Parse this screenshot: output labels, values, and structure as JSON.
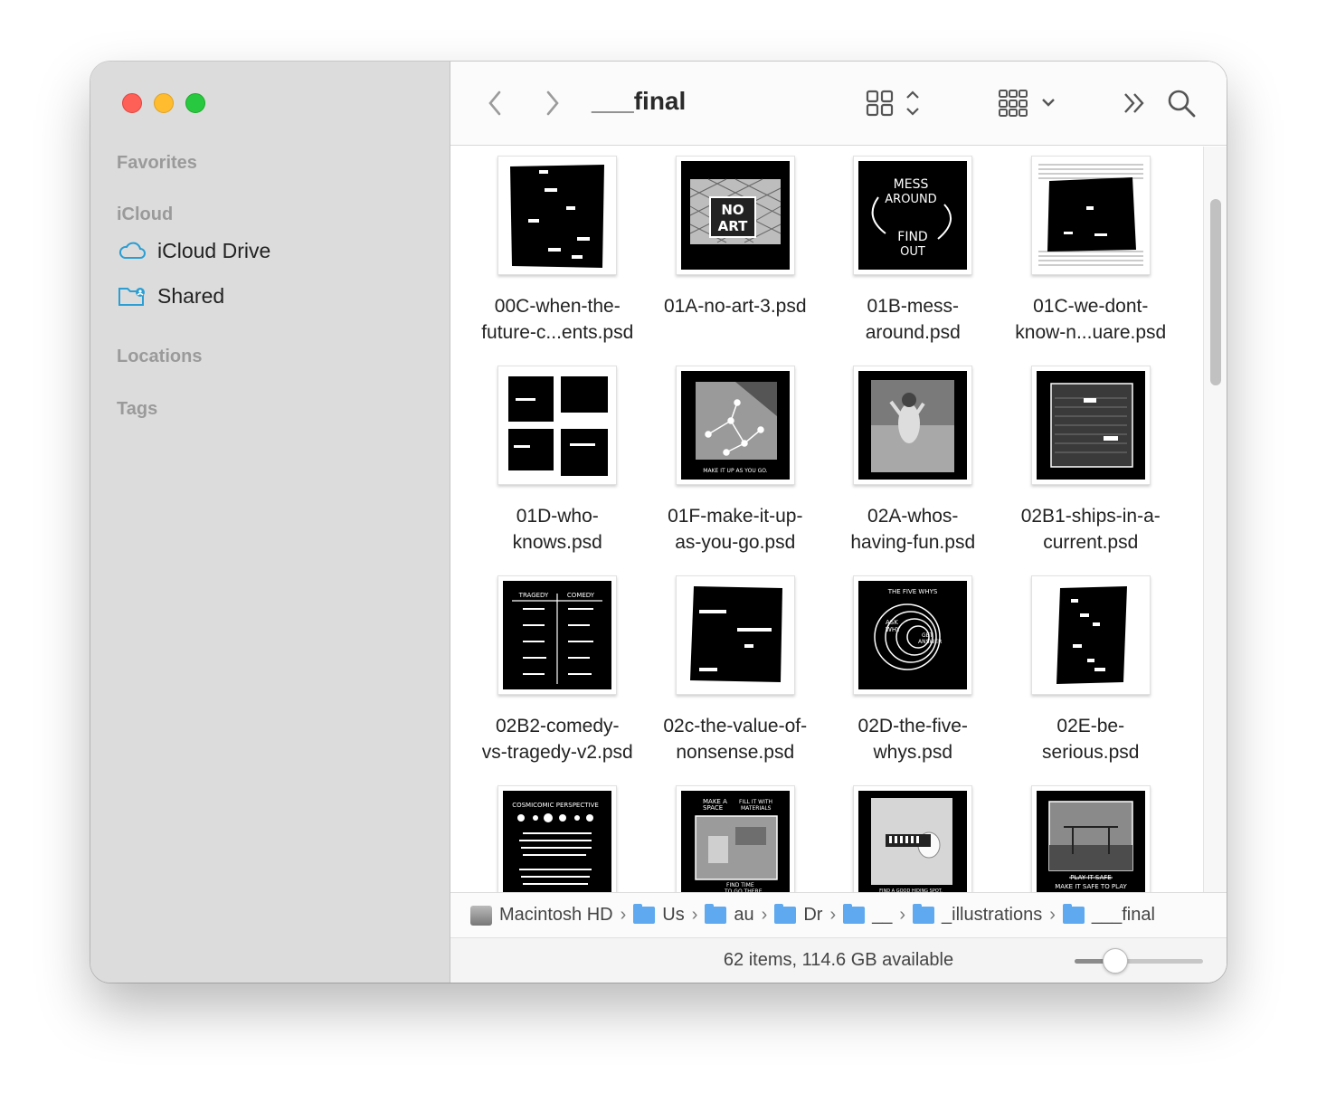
{
  "window": {
    "title": "___final"
  },
  "sidebar": {
    "favorites_header": "Favorites",
    "icloud_header": "iCloud",
    "items": [
      {
        "label": "iCloud Drive",
        "icon": "cloud-icon"
      },
      {
        "label": "Shared",
        "icon": "shared-folder-icon"
      }
    ],
    "locations_header": "Locations",
    "tags_header": "Tags"
  },
  "toolbar": {
    "back_icon": "chevron-left-icon",
    "forward_icon": "chevron-right-icon",
    "view_icon": "icon-grid-view-icon",
    "group_icon": "group-by-icon",
    "more_icon": "double-chevron-icon",
    "search_icon": "search-icon"
  },
  "files": [
    {
      "name": "00C-when-the-\nfuture-c...ents.psd"
    },
    {
      "name": "01A-no-art-3.psd"
    },
    {
      "name": "01B-mess-\naround.psd"
    },
    {
      "name": "01C-we-dont-\nknow-n...uare.psd"
    },
    {
      "name": "01D-who-\nknows.psd"
    },
    {
      "name": "01F-make-it-up-\nas-you-go.psd"
    },
    {
      "name": "02A-whos-\nhaving-fun.psd"
    },
    {
      "name": "02B1-ships-in-a-\ncurrent.psd"
    },
    {
      "name": "02B2-comedy-\nvs-tragedy-v2.psd"
    },
    {
      "name": "02c-the-value-of-\nnonsense.psd"
    },
    {
      "name": "02D-the-five-\nwhys.psd"
    },
    {
      "name": "02E-be-\nserious.psd"
    },
    {
      "name": ""
    },
    {
      "name": ""
    },
    {
      "name": ""
    },
    {
      "name": ""
    }
  ],
  "thumb_text": {
    "no_art": "NO\nART",
    "mess": "MESS\nAROUND",
    "find": "FIND\nOUT",
    "make_it_up": "MAKE IT UP AS YOU GO.",
    "tragedy": "TRAGEDY",
    "comedy": "COMEDY",
    "five_whys": "THE FIVE WHYS",
    "ask_why": "ASK\nWHY",
    "get_answer": "GET\nANSWER",
    "cosmicomic": "COSMICOMIC PERSPECTIVE",
    "make_a_space": "MAKE A\nSPACE",
    "fill_it": "FILL IT WITH\nMATERIALS",
    "find_time": "FIND TIME\nTO GO THERE",
    "good_hiding": "FIND A GOOD HIDING SPOT.",
    "play_it_safe": "PLAY IT SAFE",
    "make_it_safe": "MAKE IT SAFE TO PLAY"
  },
  "pathbar": [
    {
      "label": "Macintosh HD",
      "icon": "disk-icon"
    },
    {
      "label": "Us",
      "icon": "user-folder-icon"
    },
    {
      "label": "au",
      "icon": "home-folder-icon"
    },
    {
      "label": "Dr",
      "icon": "dropbox-folder-icon"
    },
    {
      "label": "__",
      "icon": "folder-icon"
    },
    {
      "label": "_illustrations",
      "icon": "folder-icon"
    },
    {
      "label": "___final",
      "icon": "folder-icon"
    }
  ],
  "status": {
    "text": "62 items, 114.6 GB available",
    "zoom_fraction": 0.22
  }
}
